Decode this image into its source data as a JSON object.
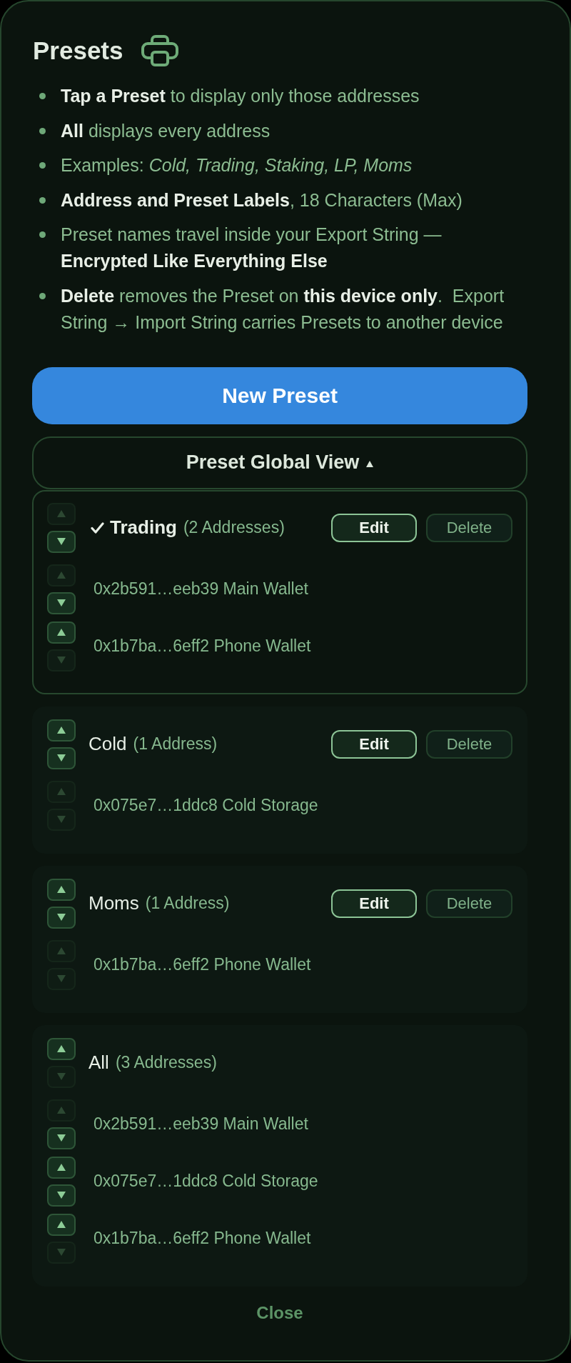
{
  "title": "Presets",
  "tips": [
    "**Tap a Preset** to display only those addresses",
    "**All** displays every address",
    "Examples: *Cold, Trading, Staking, LP, Moms*",
    "**Address and Preset Labels**, 18 Characters (Max)",
    "Preset names travel inside your Export String — **Encrypted Like Everything Else**",
    "**Delete** removes the Preset on **this device only**.  Export String → Import String carries Presets to another device"
  ],
  "new_preset_button": "New Preset",
  "global_view": {
    "label": "Preset Global View",
    "expanded": true
  },
  "presets": [
    {
      "name": "Trading",
      "count": "(2 Addresses)",
      "selected": true,
      "arrows": [
        {
          "kind": "up",
          "disabled": true
        },
        {
          "kind": "down",
          "disabled": false
        }
      ],
      "actions": [
        {
          "kind": "edit",
          "label": "Edit"
        },
        {
          "kind": "delete",
          "label": "Delete"
        }
      ],
      "addresses": [
        {
          "text": "0x2b591…eeb39 Main Wallet",
          "arrows": [
            {
              "kind": "up",
              "disabled": true
            },
            {
              "kind": "down",
              "disabled": false
            }
          ]
        },
        {
          "text": "0x1b7ba…6eff2 Phone Wallet",
          "arrows": [
            {
              "kind": "up",
              "disabled": false
            },
            {
              "kind": "down",
              "disabled": true
            }
          ]
        }
      ]
    },
    {
      "name": "Cold",
      "count": "(1 Address)",
      "selected": false,
      "arrows": [
        {
          "kind": "up",
          "disabled": false
        },
        {
          "kind": "down",
          "disabled": false
        }
      ],
      "actions": [
        {
          "kind": "edit",
          "label": "Edit"
        },
        {
          "kind": "delete",
          "label": "Delete"
        }
      ],
      "addresses": [
        {
          "text": "0x075e7…1ddc8 Cold Storage",
          "arrows": [
            {
              "kind": "up",
              "disabled": true
            },
            {
              "kind": "down",
              "disabled": true
            }
          ]
        }
      ]
    },
    {
      "name": "Moms",
      "count": "(1 Address)",
      "selected": false,
      "arrows": [
        {
          "kind": "up",
          "disabled": false
        },
        {
          "kind": "down",
          "disabled": false
        }
      ],
      "actions": [
        {
          "kind": "edit",
          "label": "Edit"
        },
        {
          "kind": "delete",
          "label": "Delete"
        }
      ],
      "addresses": [
        {
          "text": "0x1b7ba…6eff2 Phone Wallet",
          "arrows": [
            {
              "kind": "up",
              "disabled": true
            },
            {
              "kind": "down",
              "disabled": true
            }
          ]
        }
      ]
    },
    {
      "name": "All",
      "count": "(3 Addresses)",
      "selected": false,
      "arrows": [
        {
          "kind": "up",
          "disabled": false
        },
        {
          "kind": "down",
          "disabled": true
        }
      ],
      "addresses": [
        {
          "text": "0x2b591…eeb39 Main Wallet",
          "arrows": [
            {
              "kind": "up",
              "disabled": true
            },
            {
              "kind": "down",
              "disabled": false
            }
          ]
        },
        {
          "text": "0x075e7…1ddc8 Cold Storage",
          "arrows": [
            {
              "kind": "up",
              "disabled": false
            },
            {
              "kind": "down",
              "disabled": false
            }
          ]
        },
        {
          "text": "0x1b7ba…6eff2 Phone Wallet",
          "arrows": [
            {
              "kind": "up",
              "disabled": false
            },
            {
              "kind": "down",
              "disabled": true
            }
          ]
        }
      ]
    }
  ],
  "close_button": "Close"
}
